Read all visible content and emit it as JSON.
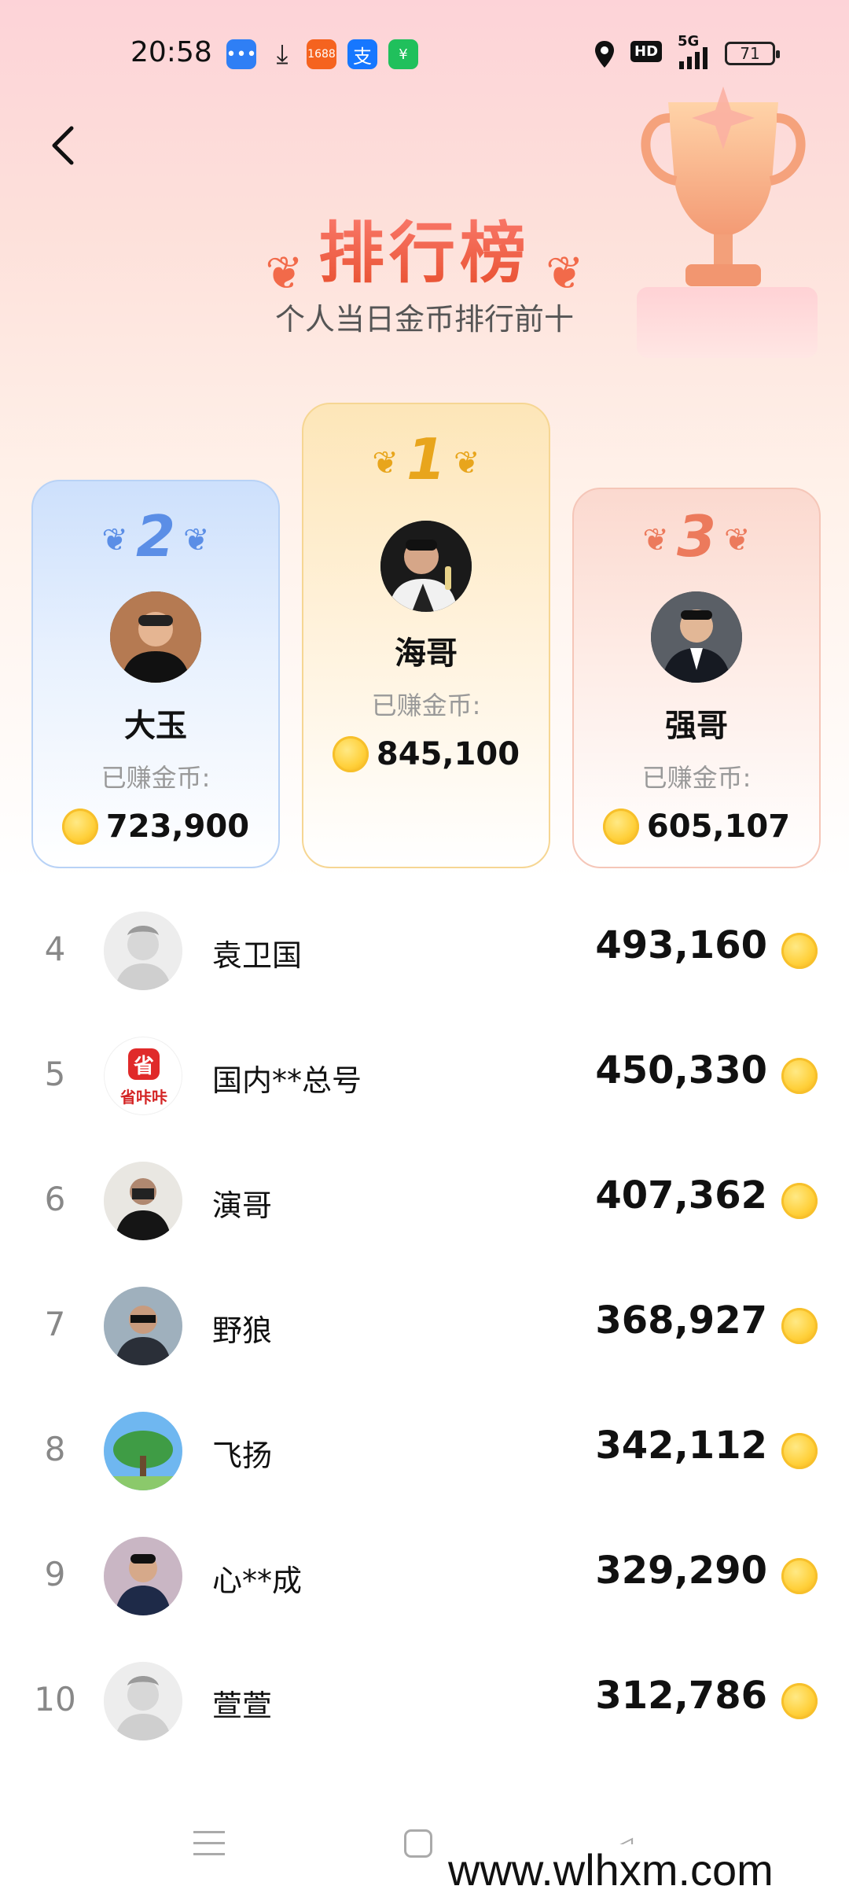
{
  "status_bar": {
    "time": "20:58",
    "network": "5G",
    "battery": "71",
    "hd_badge": "HD",
    "app_icons": [
      "message-app",
      "download",
      "1688",
      "alipay",
      "wechat"
    ]
  },
  "header": {
    "title": "排行榜",
    "subtitle": "个人当日金币排行前十"
  },
  "podium": [
    {
      "rank": "1",
      "name": "海哥",
      "earned_label": "已赚金币:",
      "coins": "845,100"
    },
    {
      "rank": "2",
      "name": "大玉",
      "earned_label": "已赚金币:",
      "coins": "723,900"
    },
    {
      "rank": "3",
      "name": "强哥",
      "earned_label": "已赚金币:",
      "coins": "605,107"
    }
  ],
  "list": [
    {
      "rank": "4",
      "name": "袁卫国",
      "coins": "493,160"
    },
    {
      "rank": "5",
      "name": "国内**总号",
      "coins": "450,330",
      "avatar_text": "省咔咔"
    },
    {
      "rank": "6",
      "name": "演哥",
      "coins": "407,362"
    },
    {
      "rank": "7",
      "name": "野狼",
      "coins": "368,927"
    },
    {
      "rank": "8",
      "name": "飞扬",
      "coins": "342,112"
    },
    {
      "rank": "9",
      "name": "心**成",
      "coins": "329,290"
    },
    {
      "rank": "10",
      "name": "萱萱",
      "coins": "312,786"
    }
  ],
  "watermark": "www.wlhxm.com",
  "colors": {
    "accent": "#e8502f",
    "gold": "#e8a51c",
    "silver": "#5b8ee6",
    "bronze": "#ec7a5c"
  }
}
